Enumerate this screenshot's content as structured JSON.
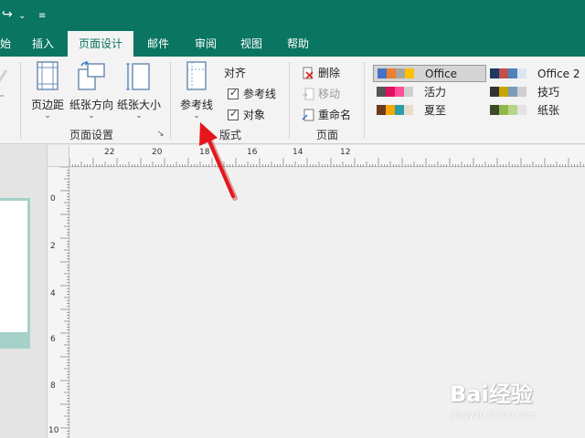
{
  "titlebar": {
    "redo_glyph": "↪",
    "dropdown_glyph": "⌄",
    "customize_glyph": "≡"
  },
  "tabs": [
    {
      "label": "始",
      "active": false
    },
    {
      "label": "插入",
      "active": false
    },
    {
      "label": "页面设计",
      "active": true
    },
    {
      "label": "邮件",
      "active": false
    },
    {
      "label": "审阅",
      "active": false
    },
    {
      "label": "视图",
      "active": false
    },
    {
      "label": "帮助",
      "active": false
    }
  ],
  "ribbon": {
    "page_setup": {
      "group_label": "页面设置",
      "margins": "页边距",
      "orientation": "纸张方向",
      "size": "纸张大小",
      "chevron": "⌄",
      "launcher": "↘"
    },
    "layout": {
      "group_label": "版式",
      "guides": "参考线",
      "align_label": "对齐",
      "align_guides": "参考线",
      "align_objects": "对象",
      "guides_checked": true,
      "objects_checked": true,
      "chevron": "⌄"
    },
    "pages": {
      "group_label": "页面",
      "delete": "删除",
      "move": "移动",
      "rename": "重命名"
    },
    "themes": [
      {
        "label": "Office",
        "colors": [
          "#4472c4",
          "#ed7d31",
          "#a5a5a5",
          "#ffc000"
        ],
        "selected": true
      },
      {
        "label": "Office 2",
        "colors": [
          "#1f3864",
          "#c0504d",
          "#4f81bd",
          "#dbe5f1"
        ],
        "selected": false
      },
      {
        "label": "活力",
        "colors": [
          "#555555",
          "#e0115f",
          "#ff4f9a",
          "#d0d0d0"
        ],
        "selected": false
      },
      {
        "label": "技巧",
        "colors": [
          "#333333",
          "#c9a500",
          "#7a9cb8",
          "#cfcfcf"
        ],
        "selected": false
      },
      {
        "label": "夏至",
        "colors": [
          "#6b3a1e",
          "#f6a800",
          "#2a9ea8",
          "#e6dcc8"
        ],
        "selected": false
      },
      {
        "label": "纸张",
        "colors": [
          "#3d4a2a",
          "#8fb84a",
          "#b7d58a",
          "#e3e3e3"
        ],
        "selected": false
      }
    ]
  },
  "ruler": {
    "horizontal_labels": [
      "22",
      "20",
      "18",
      "16",
      "14",
      "12"
    ],
    "vertical_labels": [
      "0",
      "2",
      "4",
      "6",
      "8",
      "10"
    ]
  },
  "watermark": {
    "logo": "Bai经验",
    "url": "jingyan.baidu.com"
  },
  "colors": {
    "accent": "#0a7560",
    "arrow": "#e3161b"
  }
}
